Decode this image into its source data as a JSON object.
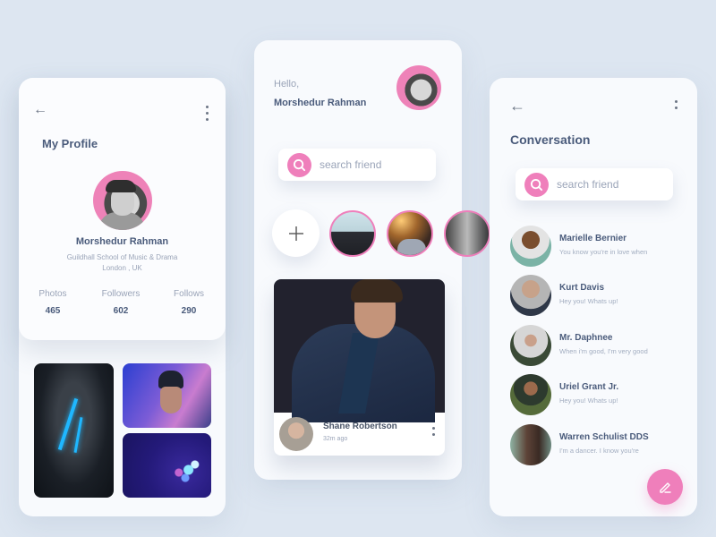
{
  "colors": {
    "background": "#dde6f1",
    "card": "#f8fafd",
    "accent_pink": "#ef7fbb",
    "heading_text": "#4a5b7b",
    "muted_text": "#9aa4b8"
  },
  "profile_screen": {
    "back_icon": "arrow-left-icon",
    "menu_icon": "more-vertical-icon",
    "title": "My Profile",
    "name": "Morshedur Rahman",
    "school": "Guildhall School of Music & Drama",
    "location": "London , UK",
    "stats": [
      {
        "label": "Photos",
        "value": "465"
      },
      {
        "label": "Followers",
        "value": "602"
      },
      {
        "label": "Follows",
        "value": "290"
      }
    ],
    "gallery": [
      {
        "description": "man with glowing blue face paint"
      },
      {
        "description": "man in beanie with neon lights"
      },
      {
        "description": "isometric neon cubes illustration"
      }
    ]
  },
  "home_screen": {
    "greeting": "Hello,",
    "user_name": "Morshedur Rahman",
    "search_placeholder": "search friend",
    "search_icon": "search-icon",
    "add_story_icon": "plus-icon",
    "stories_count_visible": 3,
    "post": {
      "author": "Shane Robertson",
      "time": "32m ago",
      "menu_icon": "more-vertical-icon"
    }
  },
  "conversation_screen": {
    "back_icon": "arrow-left-icon",
    "menu_icon": "more-vertical-icon",
    "title": "Conversation",
    "search_placeholder": "search friend",
    "conversations": [
      {
        "name": "Marielle Bernier",
        "message": "You know you're in love when"
      },
      {
        "name": "Kurt Davis",
        "message": "Hey you! Whats up!"
      },
      {
        "name": "Mr. Daphnee",
        "message": "When i'm good, I'm very good"
      },
      {
        "name": "Uriel Grant Jr.",
        "message": "Hey you! Whats up!"
      },
      {
        "name": "Warren Schulist DDS",
        "message": "I'm a dancer. I know you're"
      }
    ],
    "compose_icon": "pencil-icon"
  }
}
